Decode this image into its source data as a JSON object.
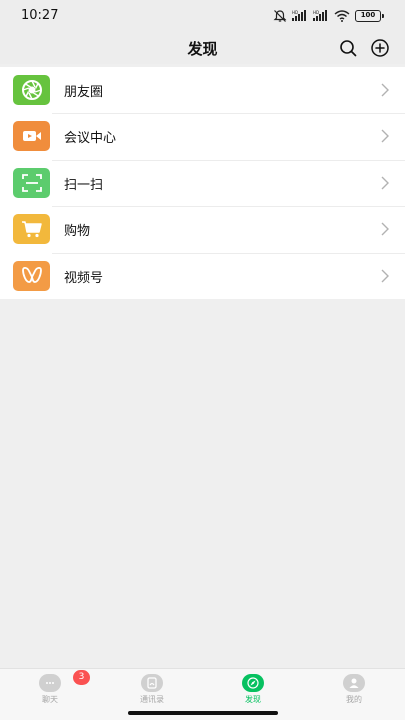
{
  "status_bar": {
    "time": "10:27",
    "battery": "100",
    "icons": [
      "mute-bell-icon",
      "hd-signal-icon",
      "hd-signal-icon",
      "wifi-icon",
      "battery-icon"
    ]
  },
  "header": {
    "title": "发现",
    "search_icon": "search-icon",
    "add_icon": "add-circle-icon"
  },
  "menu": {
    "items": [
      {
        "label": "朋友圈",
        "icon": "moments-icon",
        "color": "#66c33e"
      },
      {
        "label": "会议中心",
        "icon": "video-camera-icon",
        "color": "#f08d3c"
      },
      {
        "label": "扫一扫",
        "icon": "scan-icon",
        "color": "#5ccc6d"
      },
      {
        "label": "购物",
        "icon": "cart-icon",
        "color": "#f2b83c"
      },
      {
        "label": "视频号",
        "icon": "channels-icon",
        "color": "#f39b45"
      }
    ]
  },
  "tabbar": {
    "tabs": [
      {
        "label": "聊天",
        "icon": "chat-icon",
        "badge": "3"
      },
      {
        "label": "通讯录",
        "icon": "contacts-icon"
      },
      {
        "label": "发现",
        "icon": "compass-icon",
        "active": true
      },
      {
        "label": "我的",
        "icon": "profile-icon"
      }
    ]
  },
  "colors": {
    "accent": "#07c160",
    "badge": "#fa5151",
    "background": "#efefef"
  }
}
